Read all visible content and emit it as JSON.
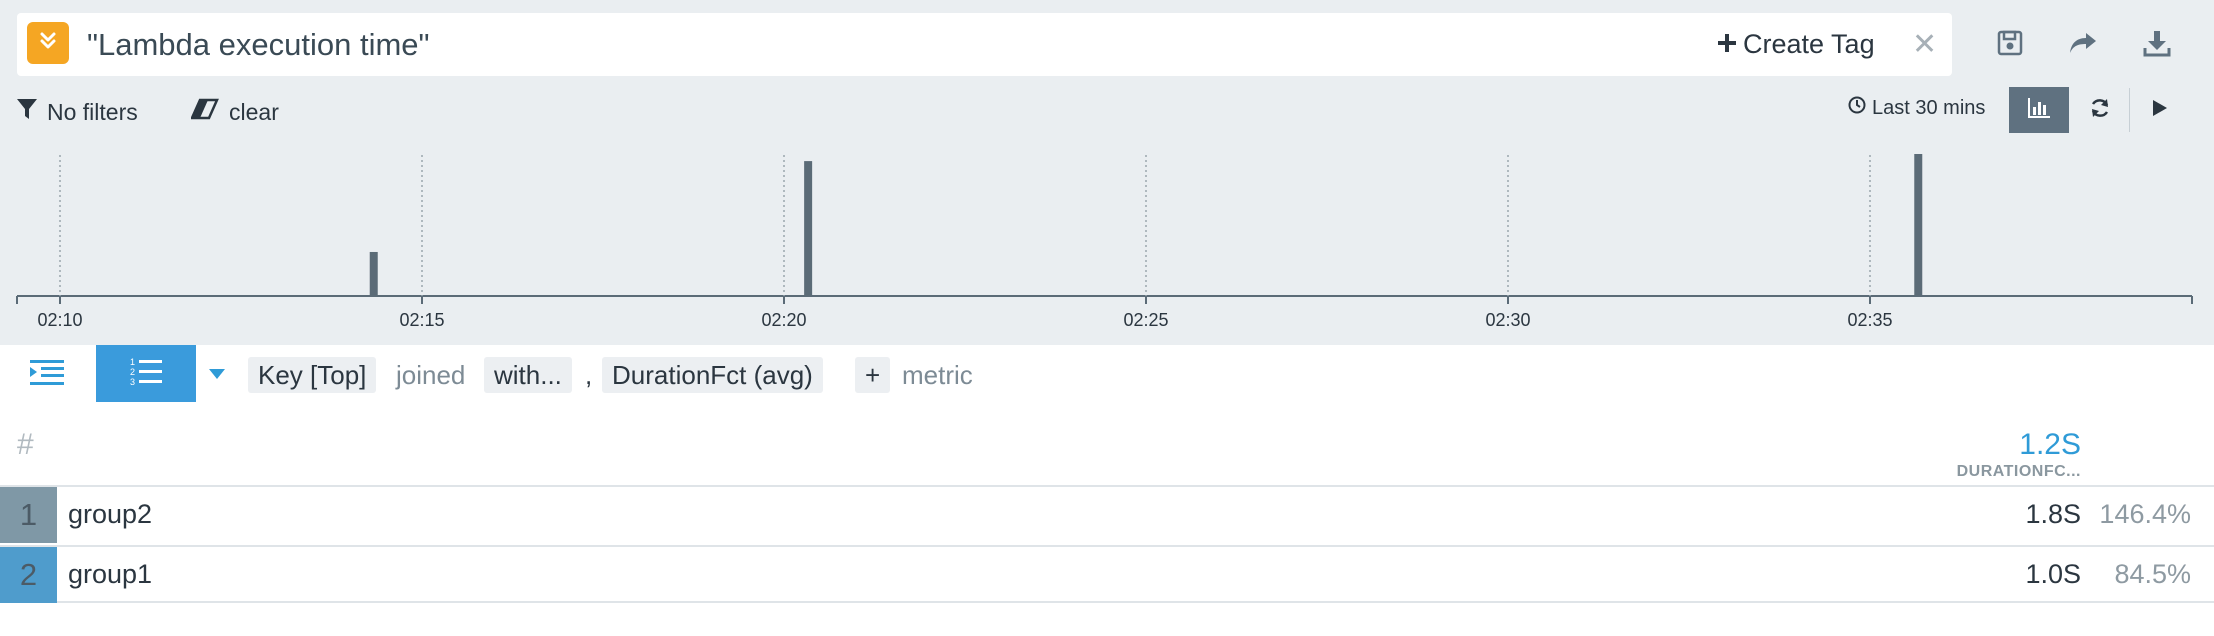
{
  "query": {
    "title": "\"Lambda execution time\"",
    "create_tag_label": "Create Tag",
    "close_icon": "close-icon"
  },
  "toolbar": {
    "save_icon": "save-icon",
    "share_icon": "share-icon",
    "download_icon": "download-icon"
  },
  "filters": {
    "no_filters_label": "No filters",
    "clear_label": "clear",
    "time_range_label": "Last 30 mins"
  },
  "histogram": {
    "x_ticks": [
      "02:10",
      "02:15",
      "02:20",
      "02:25",
      "02:30",
      "02:35"
    ],
    "bars": [
      {
        "time": "02:14:20",
        "value": 0.31
      },
      {
        "time": "02:20:20",
        "value": 0.95
      },
      {
        "time": "02:35:40",
        "value": 1.0
      }
    ]
  },
  "builder": {
    "key_pill": "Key [Top]",
    "joined_text": "joined",
    "with_pill": "with...",
    "comma": ",",
    "metric_pill": "DurationFct (avg)",
    "plus_pill": "+",
    "metric_text": "metric"
  },
  "table": {
    "hash_header": "#",
    "total_value": "1.2S",
    "metric_header": "DURATIONFC...",
    "rows": [
      {
        "rank": "1",
        "name": "group2",
        "value": "1.8S",
        "pct": "146.4%",
        "rank_color": "#7f98a6"
      },
      {
        "rank": "2",
        "name": "group1",
        "value": "1.0S",
        "pct": "84.5%",
        "rank_color": "#4f9ccc"
      }
    ]
  },
  "colors": {
    "accent_orange": "#f5a623",
    "accent_blue": "#2f9bd7",
    "bar_dark": "#5b6b77"
  }
}
